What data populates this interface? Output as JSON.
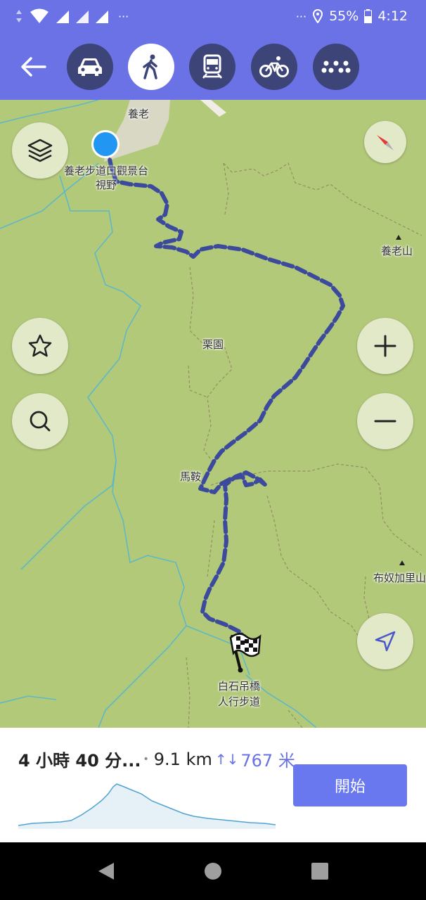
{
  "status_bar": {
    "battery": "55%",
    "time": "4:12",
    "left_dots": "···",
    "right_dots": "···",
    "icons": [
      "data-arrows-icon",
      "wifi-icon",
      "signal-icon",
      "signal-icon",
      "signal-icon",
      "location-icon",
      "battery-icon"
    ]
  },
  "toolbar": {
    "back_icon": "arrow-left-icon",
    "modes": [
      {
        "name": "car",
        "icon": "car-icon",
        "active": false
      },
      {
        "name": "walk",
        "icon": "walk-icon",
        "active": true
      },
      {
        "name": "transit",
        "icon": "train-icon",
        "active": false
      },
      {
        "name": "bike",
        "icon": "bike-icon",
        "active": false
      },
      {
        "name": "more",
        "icon": "more-dots-icon",
        "active": false
      }
    ]
  },
  "map": {
    "labels": {
      "yanglao": "養老",
      "start_place_line1": "養老步道口觀景台",
      "start_place_line2": "視野",
      "yanglao_mountain": "養老山",
      "liyuan": "栗園",
      "maan": "馬鞍",
      "bunu_mountain": "布奴加里山",
      "end_place_line1": "白石吊橋",
      "end_place_line2": "人行步道"
    },
    "colors": {
      "land": "#b3c97a",
      "route": "#3b4a9c",
      "river": "#5fb8c4",
      "road": "#e8e6e0",
      "boundary": "#8b7a5a",
      "current_location": "#2196f3"
    },
    "buttons": {
      "layers_icon": "layers-icon",
      "compass_icon": "compass-icon",
      "favorite_icon": "star-icon",
      "search_icon": "search-icon",
      "zoom_in_icon": "plus-icon",
      "zoom_out_icon": "minus-icon",
      "locate_icon": "navigate-arrow-icon",
      "finish_icon": "checkered-flag-icon"
    }
  },
  "route": {
    "duration": "4 小時 40 分...",
    "separator": "•",
    "distance": "9.1 km",
    "elevation_icon": "↑↓",
    "elevation": "767 米",
    "start_button": "開始"
  },
  "nav_bar": {
    "back_icon": "back-triangle-icon",
    "home_icon": "home-circle-icon",
    "recents_icon": "recents-square-icon"
  }
}
